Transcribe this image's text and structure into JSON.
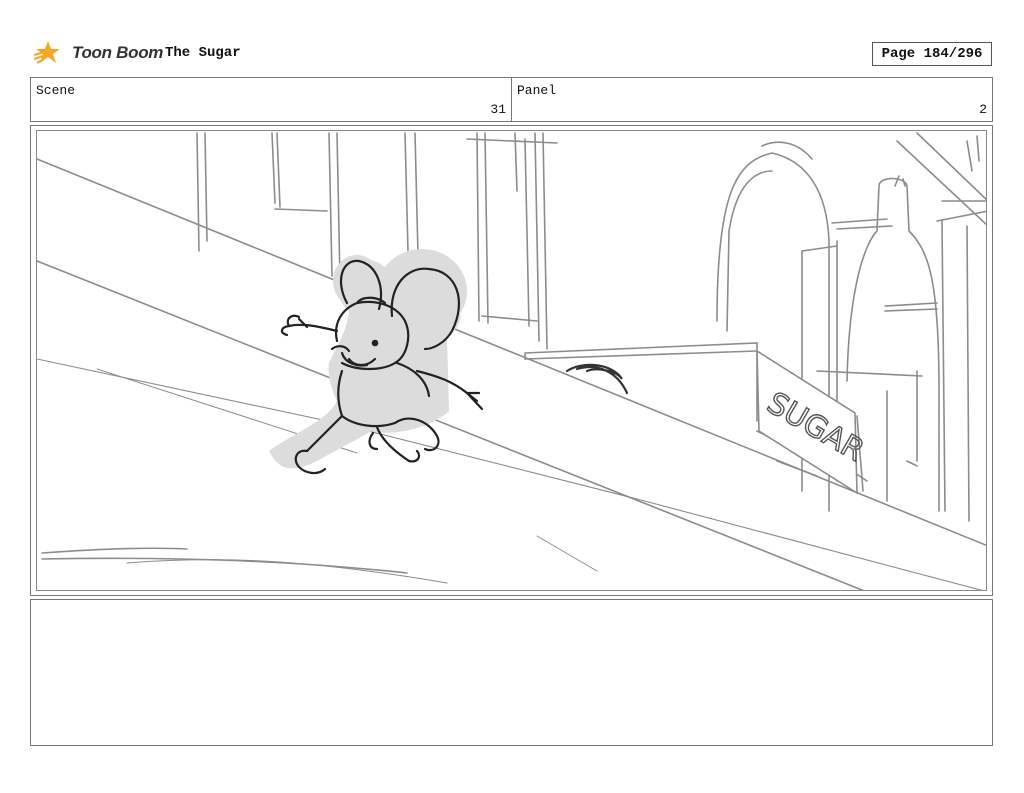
{
  "header": {
    "logo_text": "Toon Boom",
    "project_title": "The Sugar",
    "page_label": "Page 184/296"
  },
  "scene": {
    "label": "Scene",
    "value": "31"
  },
  "panel": {
    "label": "Panel",
    "value": "2"
  },
  "sketch": {
    "sign_text": "SUGAR",
    "colors": {
      "line": "#8c8c8c",
      "character_line": "#222222",
      "character_fill": "#dcdcdc"
    }
  },
  "notes": {
    "text": ""
  }
}
